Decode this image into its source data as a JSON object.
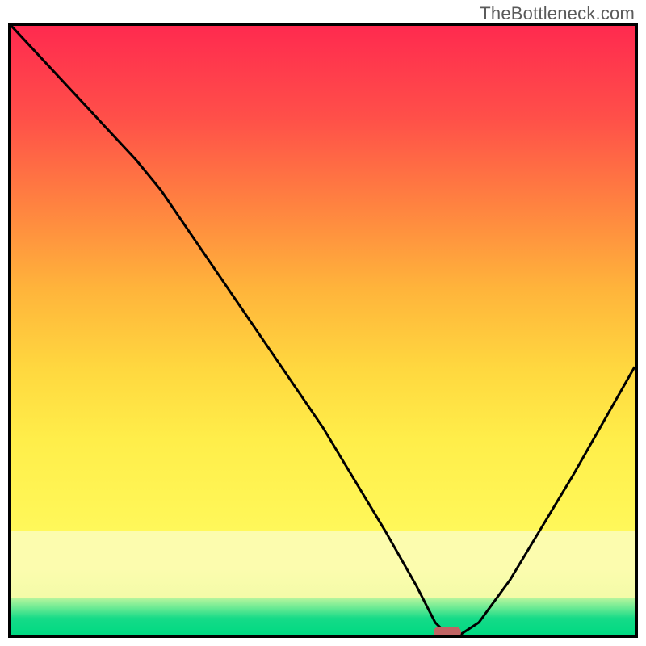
{
  "watermark": {
    "text": "TheBottleneck.com"
  },
  "chart_data": {
    "type": "line",
    "title": "",
    "xlabel": "",
    "ylabel": "",
    "xlim": [
      0,
      100
    ],
    "ylim": [
      0,
      100
    ],
    "grid": false,
    "series": [
      {
        "name": "bottleneck-curve",
        "x": [
          0,
          10,
          20,
          24,
          30,
          40,
          50,
          60,
          65,
          68,
          70,
          72,
          75,
          80,
          90,
          100
        ],
        "values": [
          100,
          89,
          78,
          73,
          64,
          49,
          34,
          17,
          8,
          2,
          0,
          0,
          2,
          9,
          26,
          44
        ]
      }
    ],
    "annotations": [
      {
        "name": "optimal-marker",
        "x": 70,
        "y": 0
      }
    ],
    "background": {
      "type": "vertical-gradient",
      "stops": [
        {
          "pos": 0.0,
          "color": "#ff2a4f"
        },
        {
          "pos": 0.5,
          "color": "#ffb43b"
        },
        {
          "pos": 0.83,
          "color": "#fff85a"
        },
        {
          "pos": 0.9,
          "color": "#fcfcae"
        },
        {
          "pos": 0.96,
          "color": "#5fe892"
        },
        {
          "pos": 1.0,
          "color": "#00d982"
        }
      ]
    }
  }
}
